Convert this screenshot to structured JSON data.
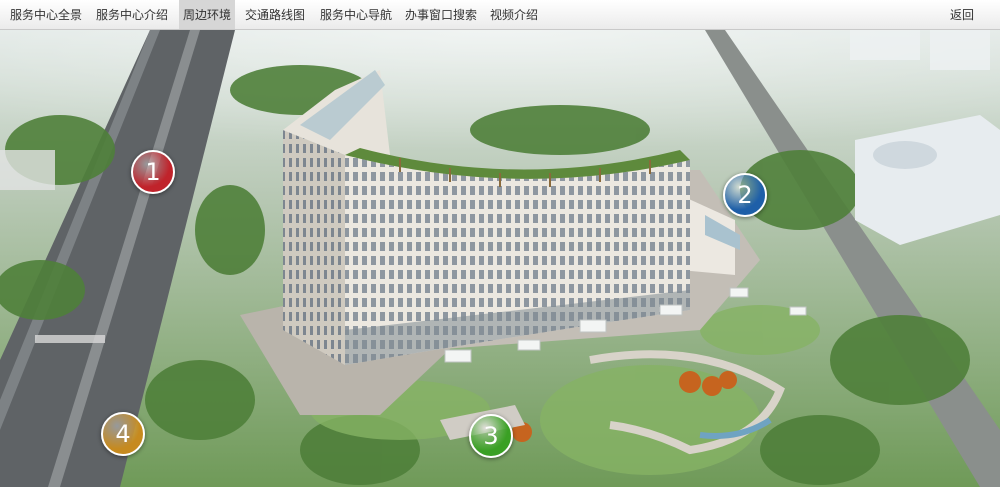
{
  "nav": {
    "items": [
      {
        "label": "服务中心全景"
      },
      {
        "label": "服务中心介绍"
      },
      {
        "label": "周边环境",
        "active": true
      },
      {
        "label": "交通路线图"
      },
      {
        "label": "服务中心导航"
      },
      {
        "label": "办事窗口搜索"
      },
      {
        "label": "视频介绍"
      }
    ],
    "back_label": "返回"
  },
  "markers": [
    {
      "label": "1",
      "color": "#c0232b"
    },
    {
      "label": "2",
      "color": "#1e5fa8"
    },
    {
      "label": "3",
      "color": "#3aa024"
    },
    {
      "label": "4",
      "color": "#c68a1f"
    }
  ],
  "colors": {
    "nav_bg": "#f4f4f4",
    "nav_active": "#d6d6d6",
    "building": "#e8e4dc",
    "roof_garden": "#5e8a3c",
    "lawn": "#6fa64a",
    "road": "#5f6366"
  }
}
